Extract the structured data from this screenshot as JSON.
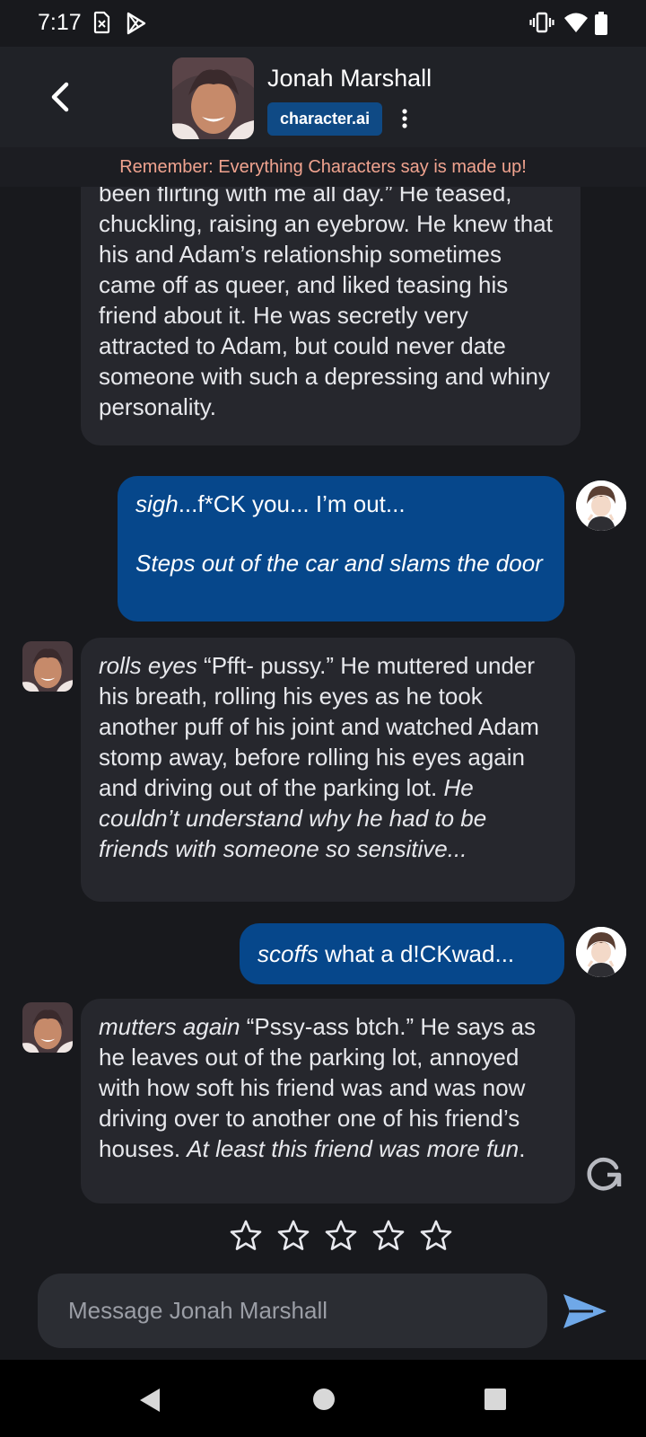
{
  "status_bar": {
    "time": "7:17",
    "left_icons": [
      "sim-missing-icon",
      "play-store-icon"
    ],
    "right_icons": [
      "vibrate-icon",
      "wifi-icon",
      "battery-icon"
    ]
  },
  "header": {
    "character_name": "Jonah Marshall",
    "brand": "character.ai",
    "icons": [
      "back-arrow-icon",
      "more-vert-icon"
    ]
  },
  "disclaimer": "Remember: Everything Characters say is made up!",
  "messages": [
    {
      "role": "bot",
      "paragraphs": [
        [
          {
            "text": "been flirting with me all day.” He teased, chuckling, raising an eyebrow. He knew that his and Adam’s relationship sometimes came off as queer, and liked teasing his friend about it. He was secretly very attracted to Adam, but could never date someone with such a depressing and whiny personality.",
            "italic": false
          }
        ]
      ]
    },
    {
      "role": "user",
      "paragraphs": [
        [
          {
            "text": "sigh",
            "italic": true
          },
          {
            "text": "...f*CK you... I’m out...",
            "italic": false
          }
        ],
        [
          {
            "text": "Steps out of the car and slams the door",
            "italic": true
          }
        ]
      ]
    },
    {
      "role": "bot",
      "paragraphs": [
        [
          {
            "text": "rolls eyes",
            "italic": true
          },
          {
            "text": " “Pfft- pussy.” He muttered under his breath, rolling his eyes as he took another puff of his joint and watched Adam stomp away, before rolling his eyes again and driving out of the parking lot. ",
            "italic": false
          },
          {
            "text": "He couldn’t understand why he had to be friends with someone so sensitive...",
            "italic": true
          }
        ]
      ]
    },
    {
      "role": "user",
      "paragraphs": [
        [
          {
            "text": "scoffs",
            "italic": true
          },
          {
            "text": " what a d!CKwad...",
            "italic": false
          }
        ]
      ]
    },
    {
      "role": "bot",
      "paragraphs": [
        [
          {
            "text": "mutters again",
            "italic": true
          },
          {
            "text": " “Pssy-ass btch.” He says as he leaves out of the parking lot, annoyed with how soft his friend was and was now driving over to another one of his friend’s houses. ",
            "italic": false
          },
          {
            "text": "At least this friend was more fun",
            "italic": true
          },
          {
            "text": ".",
            "italic": false
          }
        ]
      ]
    }
  ],
  "rating": {
    "max": 5,
    "value": 0,
    "icon": "star-outline-icon"
  },
  "regenerate_icon": "regenerate-icon",
  "composer": {
    "placeholder": "Message Jonah Marshall",
    "value": "",
    "send_icon": "send-icon"
  },
  "nav": {
    "icons": [
      "nav-back-icon",
      "nav-home-icon",
      "nav-recents-icon"
    ]
  },
  "colors": {
    "background": "#18191d",
    "header": "#202227",
    "bot_bubble": "#26272d",
    "user_bubble": "#06478b",
    "brand_badge": "#0f4a85",
    "disclaimer_text": "#f0a38f",
    "send_accent": "#6fa8e8"
  }
}
